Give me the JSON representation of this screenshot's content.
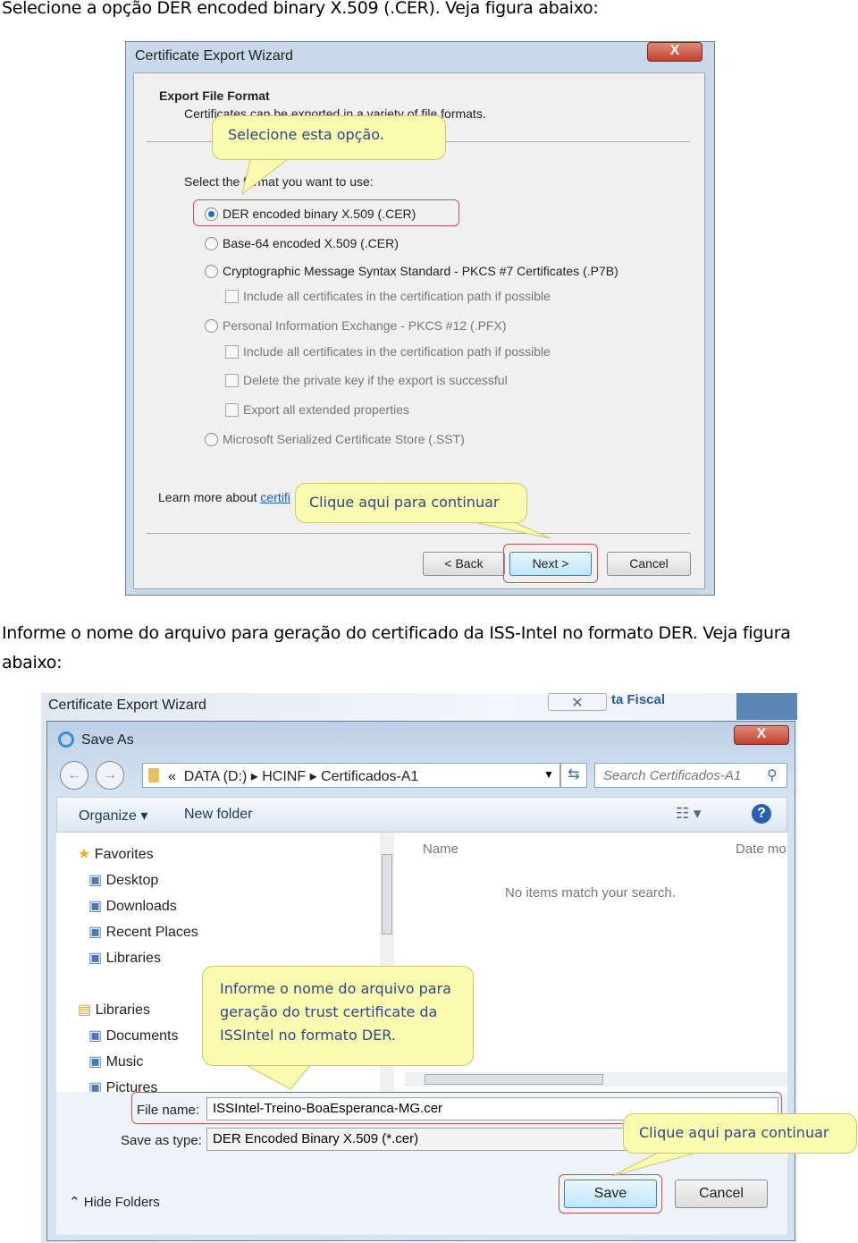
{
  "instruction1": "Selecione a opção DER encoded binary X.509 (.CER). Veja figura abaixo:",
  "wizard1": {
    "title": "Certificate Export Wizard",
    "close": "X",
    "heading": "Export File Format",
    "subheading": "Certificates can be exported in a variety of file formats.",
    "select_label": "Select the format you want to use:",
    "options": [
      {
        "label": "DER encoded binary X.509 (.CER)",
        "selected": true,
        "enabled": true
      },
      {
        "label": "Base-64 encoded X.509 (.CER)",
        "selected": false,
        "enabled": true
      },
      {
        "label": "Cryptographic Message Syntax Standard - PKCS #7 Certificates (.P7B)",
        "selected": false,
        "enabled": true
      },
      {
        "label": "Include all certificates in the certification path if possible",
        "type": "checkbox",
        "enabled": false
      },
      {
        "label": "Personal Information Exchange - PKCS #12 (.PFX)",
        "selected": false,
        "enabled": false
      },
      {
        "label": "Include all certificates in the certification path if possible",
        "type": "checkbox",
        "enabled": false
      },
      {
        "label": "Delete the private key if the export is successful",
        "type": "checkbox",
        "enabled": false
      },
      {
        "label": "Export all extended properties",
        "type": "checkbox",
        "enabled": false
      },
      {
        "label": "Microsoft Serialized Certificate Store (.SST)",
        "selected": false,
        "enabled": false
      }
    ],
    "learn_more": "Learn more about ",
    "learn_more_link": "certifi",
    "back": "< Back",
    "next": "Next >",
    "cancel": "Cancel",
    "callout_select": "Selecione esta opção.",
    "callout_continue": "Clique aqui para continuar"
  },
  "instruction2": "Informe o nome do arquivo para geração do certificado da ISS-Intel no formato DER. Veja figura abaixo:",
  "wizard2": {
    "title": "Certificate Export Wizard",
    "background_text": "ta Fiscal",
    "saveas": {
      "title": "Save As",
      "close": "X",
      "breadcrumb": [
        "«",
        "DATA (D:)",
        "HCINF",
        "Certificados-A1"
      ],
      "search_placeholder": "Search Certificados-A1",
      "organize": "Organize ▾",
      "new_folder": "New folder",
      "nav_groups": [
        {
          "label": "Favorites",
          "items": [
            "Desktop",
            "Downloads",
            "Recent Places",
            "Libraries"
          ]
        },
        {
          "label": "Libraries",
          "items": [
            "Documents",
            "Music",
            "Pictures"
          ]
        }
      ],
      "col_name": "Name",
      "col_date": "Date mo",
      "empty": "No items match your search.",
      "file_name_label": "File name:",
      "file_name": "ISSIntel-Treino-BoaEsperanca-MG.cer",
      "save_type_label": "Save as type:",
      "save_type": "DER Encoded Binary X.509 (*.cer)",
      "hide_folders": "Hide Folders",
      "save": "Save",
      "cancel": "Cancel"
    },
    "callout_name": [
      "Informe o nome do arquivo para",
      "geração do trust certificate da",
      "ISSIntel no formato DER."
    ],
    "callout_continue": "Clique aqui para continuar"
  },
  "colors": {
    "callout": "#fbfbb0",
    "callout_text": "#2a4a8a",
    "highlight": "#d05050",
    "link": "#1a5cc8"
  }
}
